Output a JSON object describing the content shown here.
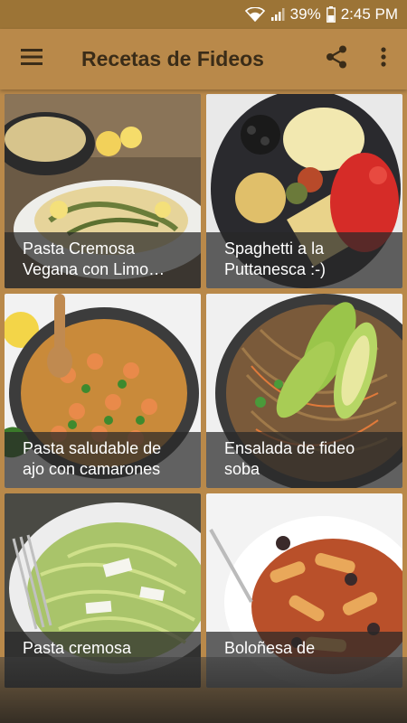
{
  "status_bar": {
    "battery": "39%",
    "time": "2:45 PM"
  },
  "app_bar": {
    "title": "Recetas de Fideos",
    "icons": [
      "menu-icon",
      "share-icon",
      "more-vert-icon"
    ]
  },
  "recipes": [
    {
      "line1": "Pasta Cremosa",
      "line2": "Vegana con Limo…"
    },
    {
      "line1": "Spaghetti a la",
      "line2": "Puttanesca :-)"
    },
    {
      "line1": "Pasta saludable de",
      "line2": "ajo con camarones"
    },
    {
      "line1": "Ensalada de fideo",
      "line2": "soba"
    },
    {
      "line1": "Pasta cremosa",
      "line2": ""
    },
    {
      "line1": "Boloñesa de",
      "line2": ""
    }
  ],
  "colors": {
    "status_bar": "#9c7436",
    "app_bar": "#b9894a",
    "title_text": "#3a2c18"
  }
}
